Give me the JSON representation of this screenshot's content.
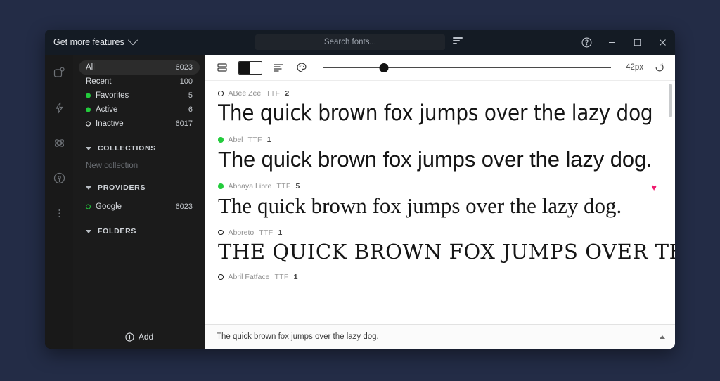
{
  "titlebar": {
    "get_more_label": "Get more features",
    "chevron_icon": "chevron-down-icon",
    "search_placeholder": "Search fonts...",
    "search_value": "",
    "sort_icon": "sort-icon",
    "help_icon": "help-circle-icon",
    "minimize_icon": "minimize-icon",
    "maximize_icon": "maximize-icon",
    "close_icon": "close-icon"
  },
  "rail": {
    "items": [
      {
        "icon": "library-icon"
      },
      {
        "icon": "activity-bolt-icon"
      },
      {
        "icon": "atom-settings-icon"
      },
      {
        "icon": "broadcast-icon"
      },
      {
        "icon": "more-vertical-icon"
      }
    ]
  },
  "sidebar": {
    "items": [
      {
        "label": "All",
        "count": "6023",
        "marker": "none",
        "selected": true
      },
      {
        "label": "Recent",
        "count": "100",
        "marker": "none",
        "selected": false
      },
      {
        "label": "Favorites",
        "count": "5",
        "marker": "green",
        "selected": false
      },
      {
        "label": "Active",
        "count": "6",
        "marker": "green",
        "selected": false
      },
      {
        "label": "Inactive",
        "count": "6017",
        "marker": "ring",
        "selected": false
      }
    ],
    "collections": {
      "title": "COLLECTIONS",
      "placeholder": "New collection"
    },
    "providers": {
      "title": "PROVIDERS",
      "items": [
        {
          "label": "Google",
          "count": "6023",
          "marker": "ring-green"
        }
      ]
    },
    "folders": {
      "title": "FOLDERS"
    },
    "add_label": "Add",
    "add_icon": "plus-circle-icon"
  },
  "toolbar": {
    "view_icon": "list-view-icon",
    "contrast_icon": "black-white-toggle-icon",
    "align_icon": "text-align-left-icon",
    "color_icon": "color-palette-icon",
    "size_label": "42px",
    "slider_percent": 21,
    "reset_icon": "reset-icon"
  },
  "font_list": {
    "items": [
      {
        "name": "ABee Zee",
        "format": "TTF",
        "styles": "2",
        "status": "ring",
        "favorite": false,
        "preview": "The quick brown fox jumps over the lazy dog",
        "style_class": "pv-abeezee"
      },
      {
        "name": "Abel",
        "format": "TTF",
        "styles": "1",
        "status": "green",
        "favorite": false,
        "preview": "The quick brown fox jumps over the lazy dog.",
        "style_class": "pv-abel"
      },
      {
        "name": "Abhaya Libre",
        "format": "TTF",
        "styles": "5",
        "status": "green",
        "favorite": true,
        "favorite_icon": "heart-icon",
        "preview": "The quick brown fox jumps over the lazy dog.",
        "style_class": "pv-abhaya"
      },
      {
        "name": "Aboreto",
        "format": "TTF",
        "styles": "1",
        "status": "ring",
        "favorite": false,
        "preview": "The quick brown fox jumps over the",
        "style_class": "pv-aboreto"
      },
      {
        "name": "Abril Fatface",
        "format": "TTF",
        "styles": "1",
        "status": "ring",
        "favorite": false,
        "preview": "",
        "style_class": "pv-abhaya"
      }
    ]
  },
  "bottom": {
    "preview_text": "The quick brown fox jumps over the lazy dog.",
    "collapse_icon": "chevron-up-icon"
  },
  "colors": {
    "accent_green": "#23cc3c",
    "favorite_pink": "#f01a6e",
    "desktop_bg": "#232c46",
    "titlebar_bg": "#141b24",
    "sidebar_bg": "#1b1b1b",
    "rail_bg": "#191919"
  }
}
